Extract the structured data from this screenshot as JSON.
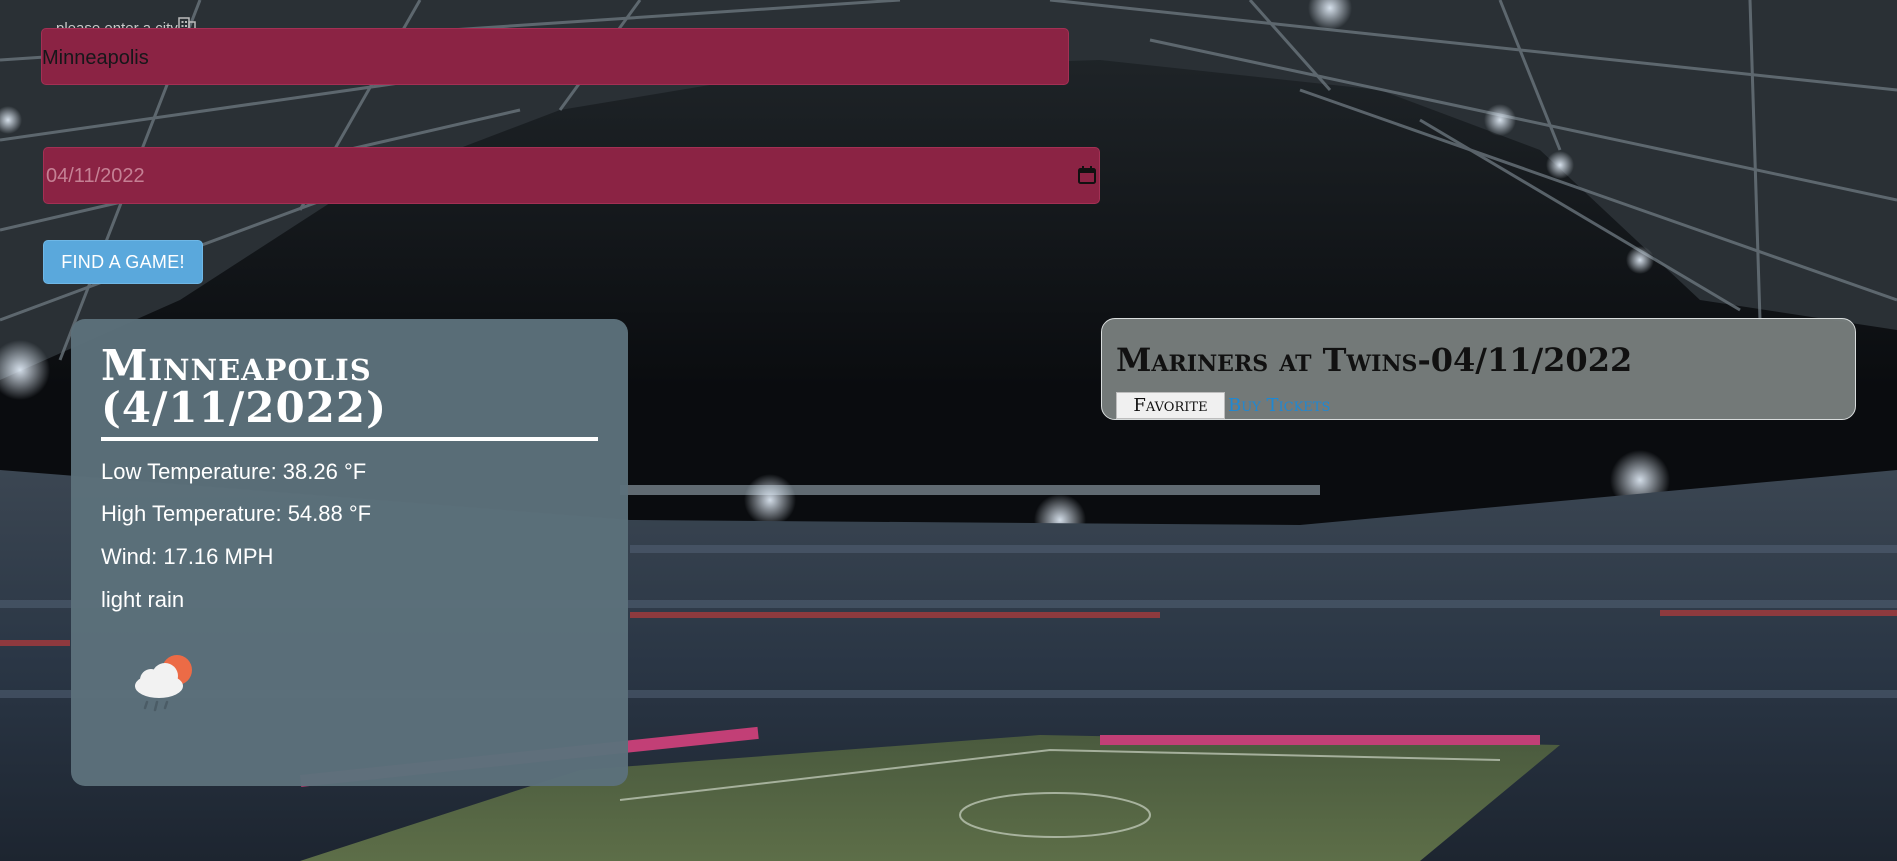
{
  "search": {
    "city_label": "please enter a city",
    "city_value": "Minneapolis",
    "date_value": "04/11/2022",
    "submit_label": "FIND A GAME!"
  },
  "weather": {
    "title": "Minneapolis (4/11/2022)",
    "low": "Low Temperature: 38.26 °F",
    "high": "High Temperature: 54.88 °F",
    "wind": "Wind: 17.16 MPH",
    "description": "light rain",
    "icon": "cloud-rain-sun-icon"
  },
  "game": {
    "title": "Mariners at Twins-04/11/2022",
    "favorite_label": "Favorite",
    "tickets_label": "Buy Tickets"
  },
  "colors": {
    "input_bg": "#8b2344",
    "button_bg": "#5aa8dc",
    "weather_card_bg": "#5c717b",
    "game_card_bg": "#787e7d",
    "link": "#1e88d3"
  },
  "background": "stadium-photo"
}
